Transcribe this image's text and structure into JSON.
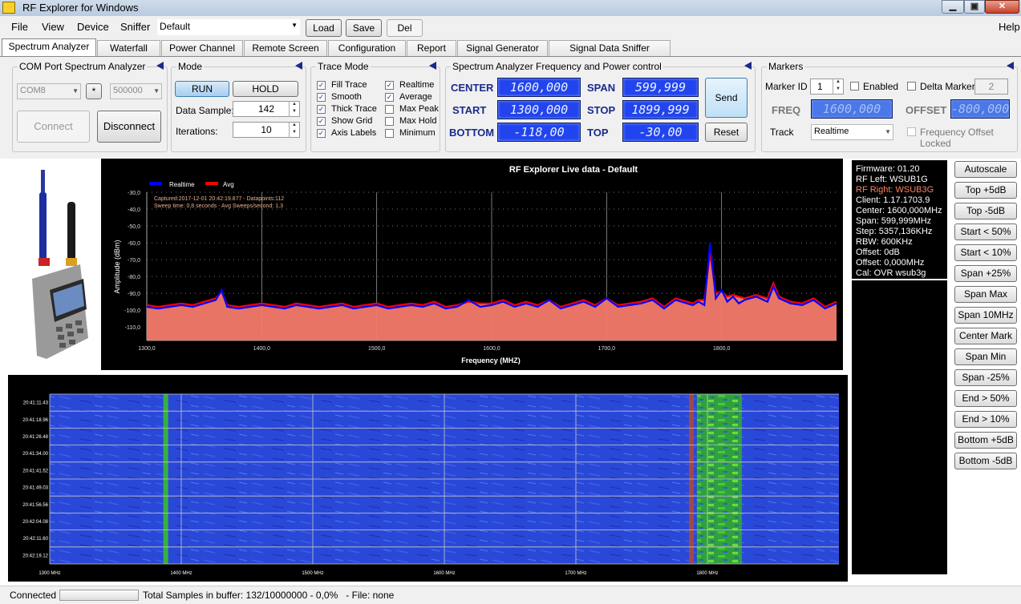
{
  "window": {
    "title": "RF Explorer for Windows",
    "logo": "rf-explorer-logo-icon"
  },
  "menu": {
    "items": [
      "File",
      "View",
      "Device",
      "Sniffer"
    ],
    "help": "Help",
    "profile": "Default",
    "load": "Load",
    "save": "Save",
    "del": "Del"
  },
  "tabs": [
    "Spectrum Analyzer",
    "Waterfall",
    "Power Channel",
    "Remote Screen",
    "Configuration",
    "Report",
    "Signal Generator",
    "Signal Data Sniffer [BETA]"
  ],
  "com": {
    "title": "COM Port Spectrum Analyzer",
    "port": "COM8",
    "star": "*",
    "baud": "500000",
    "connect": "Connect",
    "disconnect": "Disconnect"
  },
  "mode": {
    "title": "Mode",
    "run": "RUN",
    "hold": "HOLD",
    "data_sample_label": "Data Sample:",
    "data_sample": "142",
    "iterations_label": "Iterations:",
    "iterations": "10"
  },
  "trace": {
    "title": "Trace Mode",
    "items": [
      {
        "label": "Fill Trace",
        "checked": true
      },
      {
        "label": "Realtime",
        "checked": true
      },
      {
        "label": "Smooth",
        "checked": true
      },
      {
        "label": "Average",
        "checked": true
      },
      {
        "label": "Thick Trace",
        "checked": true
      },
      {
        "label": "Max Peak",
        "checked": false
      },
      {
        "label": "Show Grid",
        "checked": true
      },
      {
        "label": "Max Hold",
        "checked": false
      },
      {
        "label": "Axis Labels",
        "checked": true
      },
      {
        "label": "Minimum",
        "checked": false
      }
    ]
  },
  "freq": {
    "title": "Spectrum Analyzer Frequency and Power control",
    "center_label": "CENTER",
    "center": "1600,000",
    "span_label": "SPAN",
    "span": "599,999",
    "start_label": "START",
    "start": "1300,000",
    "stop_label": "STOP",
    "stop": "1899,999",
    "bottom_label": "BOTTOM",
    "bottom": "-118,00",
    "top_label": "TOP",
    "top": "-30,00",
    "send": "Send",
    "reset": "Reset"
  },
  "markers": {
    "title": "Markers",
    "marker_id_label": "Marker ID",
    "marker_id": "1",
    "enabled": "Enabled",
    "delta": "Delta Marker",
    "delta_id": "2",
    "freq_label": "FREQ",
    "freq": "1600,000",
    "offset_label": "OFFSET",
    "offset": "-800,000",
    "track_label": "Track",
    "track": "Realtime",
    "offset_locked": "Frequency Offset Locked"
  },
  "chart": {
    "title": "RF Explorer Live data - Default",
    "legend_realtime": "Realtime",
    "legend_avg": "Avg",
    "captured": "Captured:2017-12-01 20:42:19.877 - Datapoints:112",
    "sweep": "Sweep time: 0,8 seconds - Avg Sweeps/second: 1,3",
    "ylabel": "Amplitude (dBm)",
    "xlabel": "Frequency (MHZ)",
    "realtime_color": "#0000ff",
    "avg_color": "#ff0000",
    "fill_color": "#f47a6a"
  },
  "chart_data": {
    "type": "area",
    "title": "RF Explorer Live data - Default",
    "xlabel": "Frequency (MHZ)",
    "ylabel": "Amplitude (dBm)",
    "xlim": [
      1300,
      1900
    ],
    "ylim": [
      -118,
      -30
    ],
    "xticks": [
      "1300,0",
      "1400,0",
      "1500,0",
      "1600,0",
      "1700,0",
      "1800,0"
    ],
    "yticks": [
      "-30,0",
      "-40,0",
      "-50,0",
      "-60,0",
      "-70,0",
      "-80,0",
      "-90,0",
      "-100,0",
      "-110,0"
    ],
    "x": [
      1300,
      1310,
      1320,
      1330,
      1340,
      1350,
      1360,
      1365,
      1370,
      1380,
      1390,
      1400,
      1410,
      1420,
      1430,
      1440,
      1450,
      1460,
      1470,
      1480,
      1490,
      1500,
      1510,
      1520,
      1530,
      1540,
      1550,
      1560,
      1570,
      1580,
      1590,
      1600,
      1610,
      1620,
      1630,
      1640,
      1650,
      1660,
      1670,
      1680,
      1690,
      1700,
      1710,
      1720,
      1730,
      1740,
      1750,
      1760,
      1770,
      1775,
      1780,
      1785,
      1790,
      1795,
      1800,
      1805,
      1810,
      1815,
      1820,
      1830,
      1840,
      1845,
      1850,
      1860,
      1870,
      1880,
      1890,
      1900
    ],
    "series": [
      {
        "name": "Realtime",
        "values": [
          -98,
          -99,
          -98,
          -97,
          -98,
          -96,
          -94,
          -88,
          -98,
          -99,
          -98,
          -97,
          -98,
          -99,
          -97,
          -98,
          -99,
          -98,
          -97,
          -99,
          -98,
          -97,
          -99,
          -98,
          -97,
          -98,
          -96,
          -99,
          -98,
          -94,
          -98,
          -97,
          -95,
          -98,
          -96,
          -98,
          -94,
          -99,
          -97,
          -95,
          -98,
          -93,
          -98,
          -97,
          -96,
          -94,
          -99,
          -94,
          -96,
          -97,
          -95,
          -97,
          -60,
          -93,
          -88,
          -95,
          -92,
          -96,
          -94,
          -92,
          -95,
          -86,
          -93,
          -96,
          -97,
          -94,
          -99,
          -96
        ]
      },
      {
        "name": "Avg",
        "values": [
          -97,
          -98,
          -97,
          -96,
          -97,
          -95,
          -93,
          -89,
          -97,
          -98,
          -97,
          -96,
          -97,
          -98,
          -96,
          -97,
          -98,
          -97,
          -96,
          -98,
          -97,
          -96,
          -98,
          -97,
          -96,
          -97,
          -95,
          -98,
          -97,
          -95,
          -96,
          -96,
          -94,
          -97,
          -95,
          -97,
          -94,
          -98,
          -96,
          -94,
          -97,
          -93,
          -97,
          -96,
          -95,
          -93,
          -98,
          -93,
          -95,
          -96,
          -94,
          -94,
          -66,
          -90,
          -89,
          -92,
          -91,
          -92,
          -93,
          -91,
          -93,
          -84,
          -92,
          -95,
          -96,
          -93,
          -98,
          -95
        ]
      }
    ]
  },
  "waterfall": {
    "times": [
      "20:41:11.43",
      "20:41:18.96",
      "20:41:26.48",
      "20:41:34.00",
      "20:41:41.52",
      "20:41:49.03",
      "20:41:56.56",
      "20:42:04.08",
      "20:42:11.60",
      "20:42:19.12"
    ],
    "freqs": [
      "1300 MHz",
      "1400 MHz",
      "1500 MHz",
      "1600 MHz",
      "1700 MHz",
      "1800 MHz"
    ]
  },
  "info": {
    "lines": [
      "Firmware: 01.20",
      "RF Left: WSUB1G",
      "RF Right: WSUB3G",
      "Client: 1.17.1703.9",
      "Center: 1600,000MHz",
      "Span: 599,999MHz",
      "Step: 5357,136KHz",
      "RBW: 600KHz",
      "Offset: 0dB",
      "Offset: 0,000MHz",
      "Cal: OVR wsub3g"
    ],
    "highlight_color": "#ff8060"
  },
  "right_buttons": [
    "Autoscale",
    "Top +5dB",
    "Top -5dB",
    "Start < 50%",
    "Start < 10%",
    "Span +25%",
    "Span Max",
    "Span 10MHz",
    "Center Mark",
    "Span Min",
    "Span -25%",
    "End > 50%",
    "End > 10%",
    "Bottom +5dB",
    "Bottom -5dB"
  ],
  "status": {
    "connected": "Connected",
    "text": "Total Samples in buffer: 132/10000000 - 0,0%   - File: none"
  }
}
